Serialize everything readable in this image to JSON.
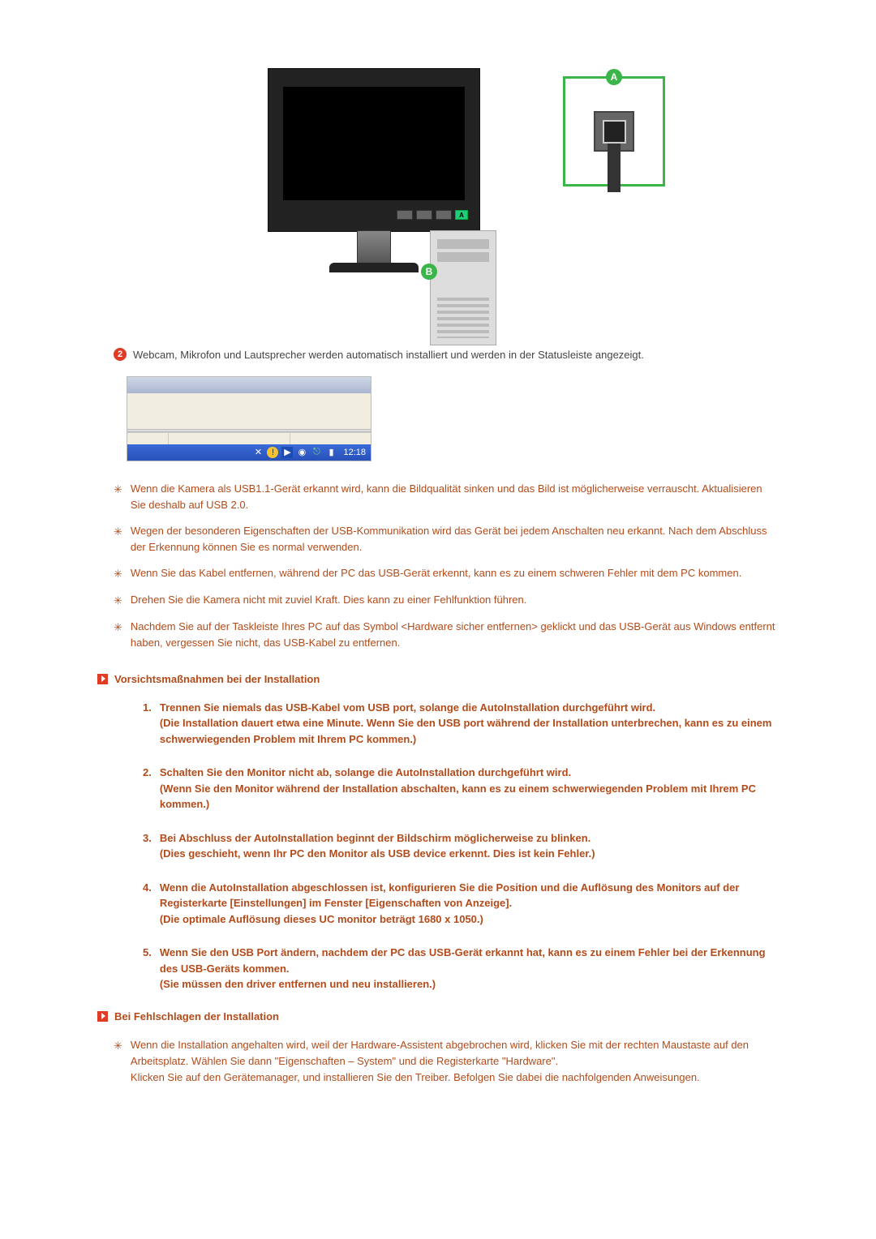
{
  "illustration": {
    "labelA": "A",
    "labelB": "B"
  },
  "step2": {
    "number": "2",
    "text": "Webcam, Mikrofon und Lautsprecher werden automatisch installiert und werden in der Statusleiste angezeigt."
  },
  "taskbar": {
    "time": "12:18"
  },
  "notes": [
    "Wenn die Kamera als USB1.1-Gerät erkannt wird, kann die Bildqualität sinken und das Bild ist möglicherweise verrauscht. Aktualisieren Sie deshalb auf USB 2.0.",
    "Wegen der besonderen Eigenschaften der USB-Kommunikation wird das Gerät bei jedem Anschalten neu erkannt. Nach dem Abschluss der Erkennung können Sie es normal verwenden.",
    "Wenn Sie das Kabel entfernen, während der PC das USB-Gerät erkennt, kann es zu einem schweren Fehler mit dem PC kommen.",
    "Drehen Sie die Kamera nicht mit zuviel Kraft. Dies kann zu einer Fehlfunktion führen.",
    "Nachdem Sie auf der Taskleiste Ihres PC auf das Symbol <Hardware sicher entfernen> geklickt und das USB-Gerät aus Windows entfernt haben, vergessen Sie nicht, das USB-Kabel zu entfernen."
  ],
  "precautions_header": "Vorsichtsmaßnahmen bei der Installation",
  "precautions": [
    "Trennen Sie niemals das USB-Kabel vom USB port, solange die AutoInstallation durchgeführt wird.\n(Die Installation dauert etwa eine Minute. Wenn Sie den USB port während der Installation unterbrechen, kann es zu einem schwerwiegenden Problem mit Ihrem PC kommen.)",
    "Schalten Sie den Monitor nicht ab, solange die AutoInstallation durchgeführt wird.\n(Wenn Sie den Monitor während der Installation abschalten, kann es zu einem schwerwiegenden Problem mit Ihrem PC kommen.)",
    "Bei Abschluss der AutoInstallation beginnt der Bildschirm möglicherweise zu blinken.\n(Dies geschieht, wenn Ihr PC den Monitor als USB device erkennt. Dies ist kein Fehler.)",
    "Wenn die AutoInstallation abgeschlossen ist, konfigurieren Sie die Position und die Auflösung des Monitors auf der Registerkarte [Einstellungen] im Fenster [Eigenschaften von Anzeige].\n(Die optimale Auflösung dieses UC monitor beträgt 1680 x 1050.)",
    "Wenn Sie den USB Port ändern, nachdem der PC das USB-Gerät erkannt hat, kann es zu einem Fehler bei der Erkennung des USB-Geräts kommen.\n(Sie müssen den driver entfernen und neu installieren.)"
  ],
  "fail_header": "Bei Fehlschlagen der Installation",
  "fail_note": "Wenn die Installation angehalten wird, weil der Hardware-Assistent abgebrochen wird, klicken Sie mit der rechten Maustaste auf den Arbeitsplatz. Wählen Sie dann \"Eigenschaften – System\" und die Registerkarte \"Hardware\".\nKlicken Sie auf den Gerätemanager, und installieren Sie den Treiber. Befolgen Sie dabei die nachfolgenden Anweisungen."
}
